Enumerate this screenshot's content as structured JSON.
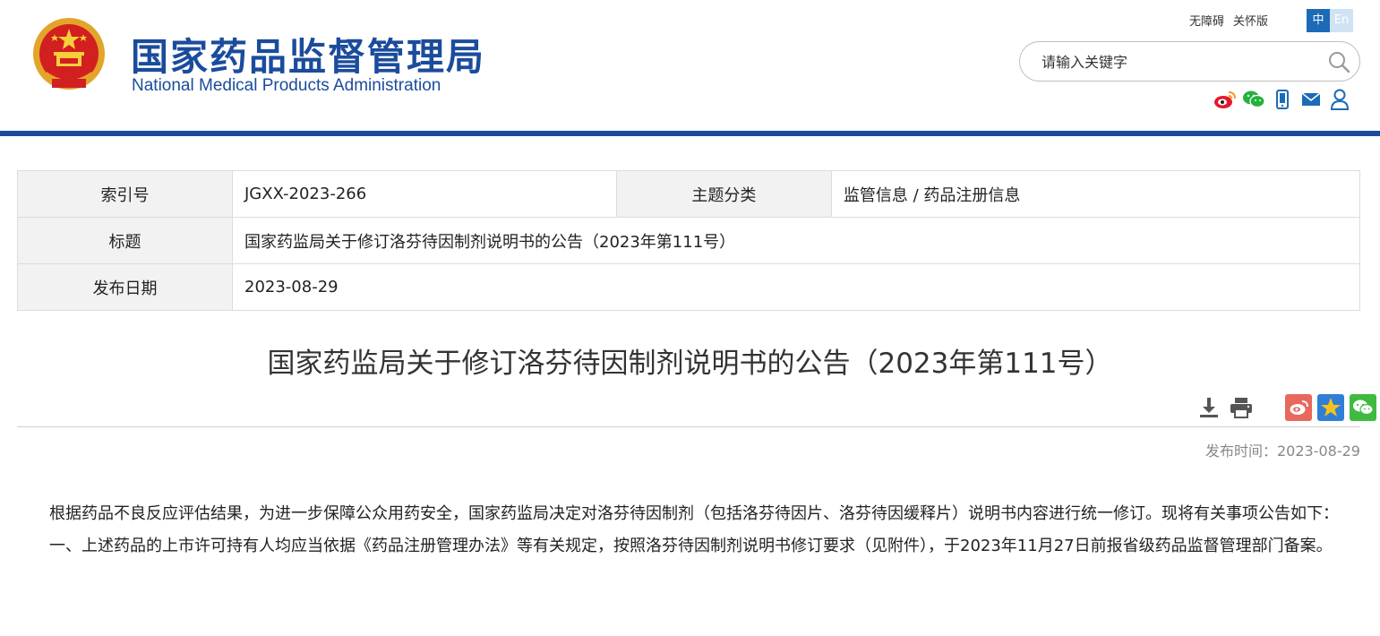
{
  "header": {
    "site_name_cn": "国家药品监督管理局",
    "site_name_en": "National Medical Products Administration",
    "accessibility_link": "无障碍",
    "elderly_link": "关怀版",
    "lang_zh": "中",
    "lang_en": "En",
    "search_placeholder": "请输入关键字",
    "social_icons": [
      "weibo-icon",
      "wechat-icon",
      "mobile-icon",
      "mail-icon",
      "user-icon"
    ]
  },
  "meta": {
    "index_label": "索引号",
    "index_value": "JGXX-2023-266",
    "category_label": "主题分类",
    "category_value": "监管信息 / 药品注册信息",
    "title_label": "标题",
    "title_value": "国家药监局关于修订洛芬待因制剂说明书的公告（2023年第111号）",
    "date_label": "发布日期",
    "date_value": "2023-08-29"
  },
  "article": {
    "title": "国家药监局关于修订洛芬待因制剂说明书的公告（2023年第111号）",
    "publish_time": "发布时间：2023-08-29",
    "paragraphs": [
      "根据药品不良反应评估结果，为进一步保障公众用药安全，国家药监局决定对洛芬待因制剂（包括洛芬待因片、洛芬待因缓释片）说明书内容进行统一修订。现将有关事项公告如下：",
      "一、上述药品的上市许可持有人均应当依据《药品注册管理办法》等有关规定，按照洛芬待因制剂说明书修订要求（见附件），于2023年11月27日前报省级药品监督管理部门备案。"
    ]
  },
  "colors": {
    "brand_blue": "#1b4c9c",
    "lang_active": "#1d6ab6",
    "share_weibo": "#e8685e",
    "share_qzone": "#2f7fd6",
    "share_wechat": "#3fba3f"
  },
  "tools": [
    "download-icon",
    "print-icon",
    "share-weibo-icon",
    "share-qzone-icon",
    "share-wechat-icon"
  ]
}
